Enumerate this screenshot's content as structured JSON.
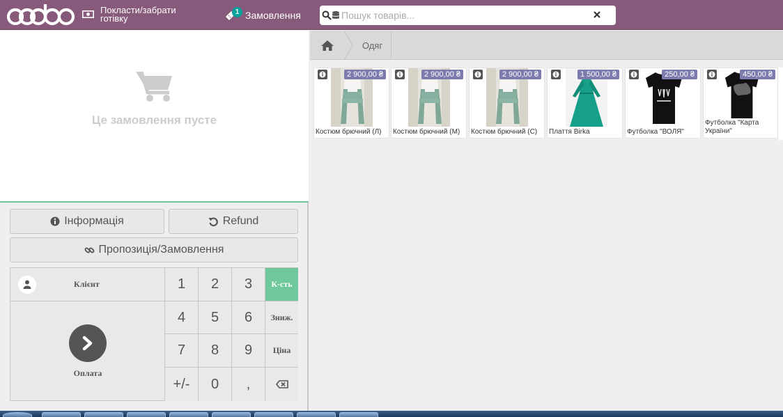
{
  "header": {
    "cash_label": "Покласти/забрати готівку",
    "orders_count": "1",
    "orders_label": "Замовлення",
    "search_placeholder": "Пошук товарів..."
  },
  "order": {
    "empty_message": "Це замовлення пусте"
  },
  "controls": {
    "info_label": "Інформація",
    "refund_label": "Refund",
    "quotation_label": "Пропозиція/Замовлення"
  },
  "pad": {
    "customer_label": "Клієнт",
    "payment_label": "Оплата",
    "keys": [
      "1",
      "2",
      "3",
      "К-сть",
      "4",
      "5",
      "6",
      "Зниж.",
      "7",
      "8",
      "9",
      "Ціна",
      "+/-",
      "0",
      ",",
      ""
    ],
    "active_mode": "К-сть"
  },
  "breadcrumb": {
    "category": "Одяг"
  },
  "products": [
    {
      "name": "Костюм брючний (Л)",
      "price": "2 900,00 ₴"
    },
    {
      "name": "Костюм брючний (М)",
      "price": "2 900,00 ₴"
    },
    {
      "name": "Костюм брючний (С)",
      "price": "2 900,00 ₴"
    },
    {
      "name": "Плаття Birka",
      "price": "1 500,00 ₴"
    },
    {
      "name": "Футболка \"ВОЛЯ\"",
      "price": "250,00 ₴"
    },
    {
      "name": "Футболка \"Карта України\"",
      "price": "450,00 ₴"
    }
  ],
  "colors": {
    "brand": "#875a7b",
    "accent": "#6ec89b",
    "price_tag": "#7c7bad",
    "badge": "#00a09d"
  },
  "icons": [
    "money-icon",
    "ticket-icon",
    "search-icon",
    "database-icon",
    "close-icon",
    "cart-icon",
    "info-circle-icon",
    "undo-icon",
    "link-icon",
    "user-icon",
    "chevron-right-icon",
    "backspace-icon",
    "home-icon"
  ]
}
